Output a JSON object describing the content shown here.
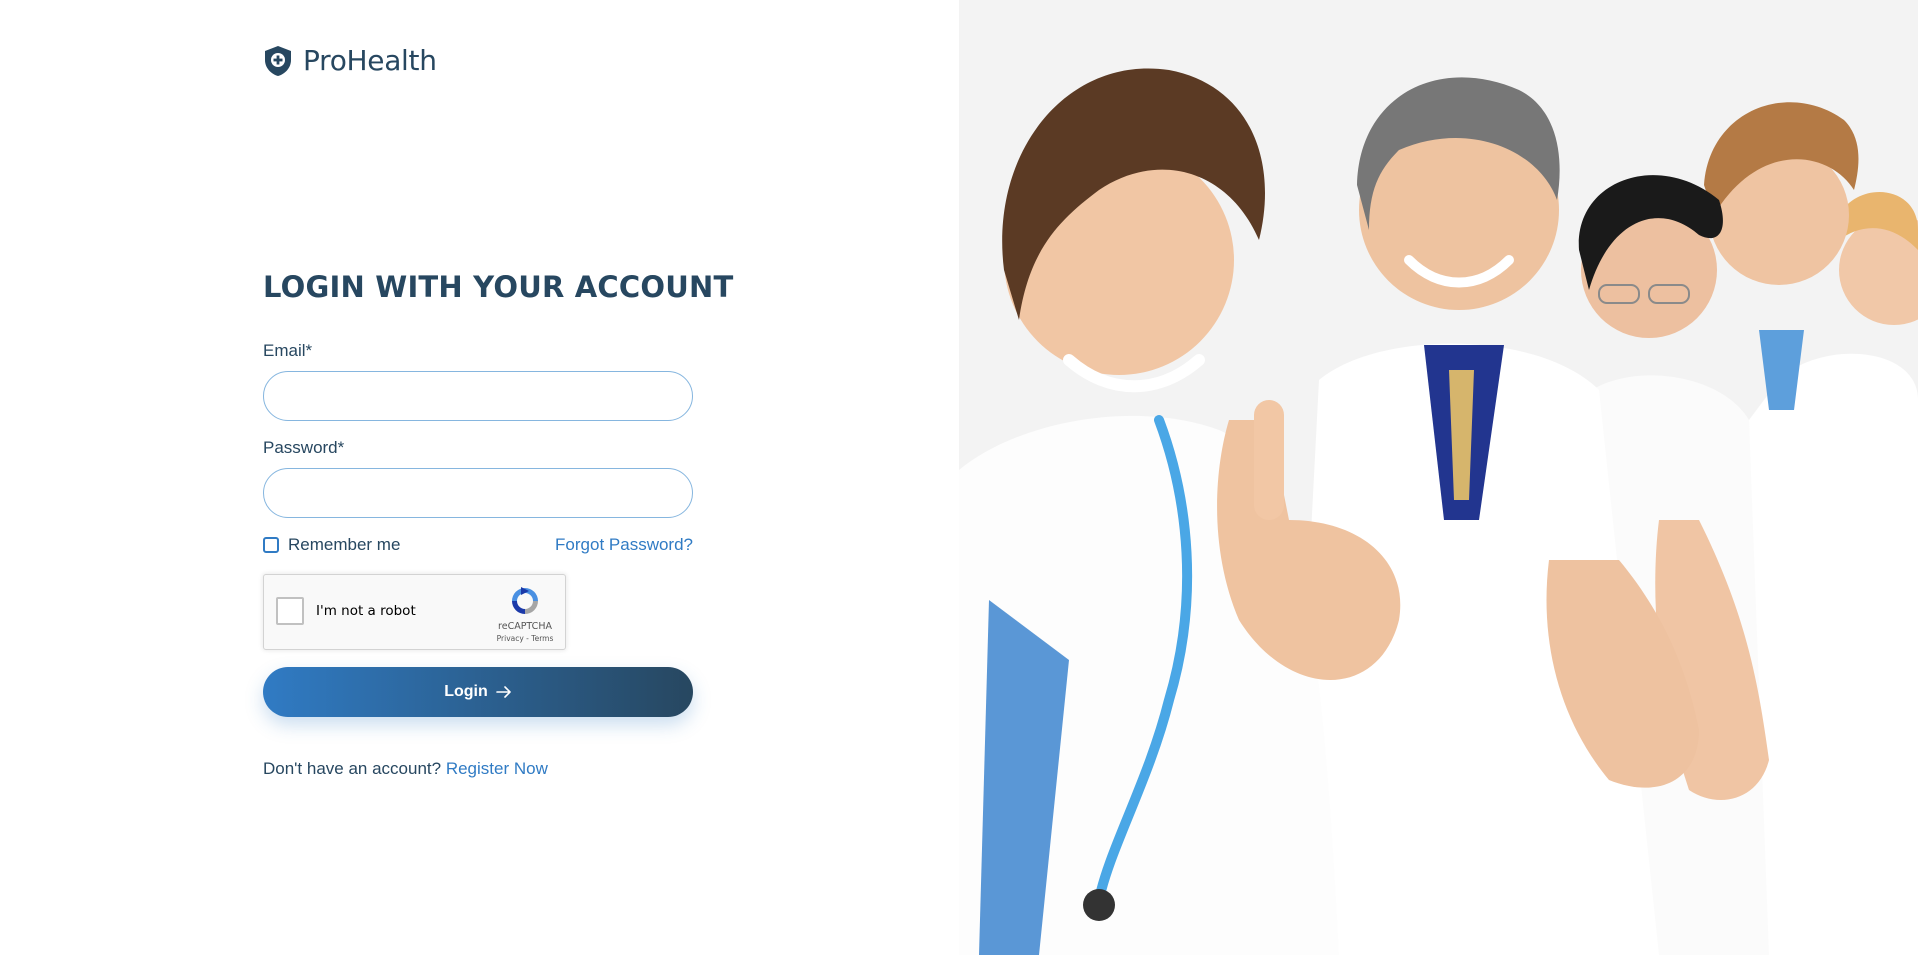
{
  "brand": {
    "name": "ProHealth",
    "icon": "shield-plus-icon"
  },
  "form": {
    "title": "LOGIN WITH YOUR ACCOUNT",
    "email": {
      "label": "Email*",
      "value": "",
      "placeholder": ""
    },
    "password": {
      "label": "Password*",
      "value": "",
      "placeholder": ""
    },
    "remember_label": "Remember me",
    "remember_checked": false,
    "forgot_label": "Forgot Password?",
    "recaptcha": {
      "label": "I'm not a robot",
      "brand": "reCAPTCHA",
      "links": "Privacy - Terms",
      "checked": false
    },
    "login_label": "Login",
    "login_icon": "arrow-right-icon",
    "register_prompt": "Don't have an account?",
    "register_link": "Register Now"
  },
  "hero_image": {
    "subject": "smiling doctors giving thumbs up",
    "icon": "hero-photo"
  },
  "colors": {
    "primary": "#274760",
    "accent": "#307bc4",
    "input_border": "#86b6df",
    "hero_background": "#f3f3f3"
  }
}
